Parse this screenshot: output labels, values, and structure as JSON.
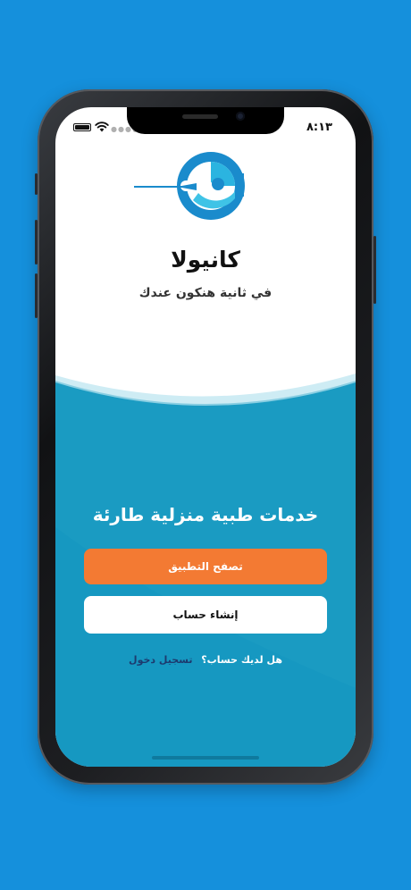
{
  "status_bar": {
    "time": "٨:١٣"
  },
  "brand": {
    "name": "كانيولا",
    "tagline": "في ثانية هنكون عندك"
  },
  "main": {
    "headline": "خدمات طبية منزلية طارئة",
    "browse_button": "تصفح التطبيق",
    "create_account_button": "إنشاء حساب",
    "login_question": "هل لديك حساب؟",
    "login_link": "تسجيل دخول"
  },
  "colors": {
    "background": "#1590dc",
    "teal": "#1a9bc2",
    "orange": "#f37a33",
    "navy": "#1d3a6e"
  },
  "icons": [
    "battery-icon",
    "wifi-icon",
    "signal-icon",
    "logo-icon"
  ]
}
